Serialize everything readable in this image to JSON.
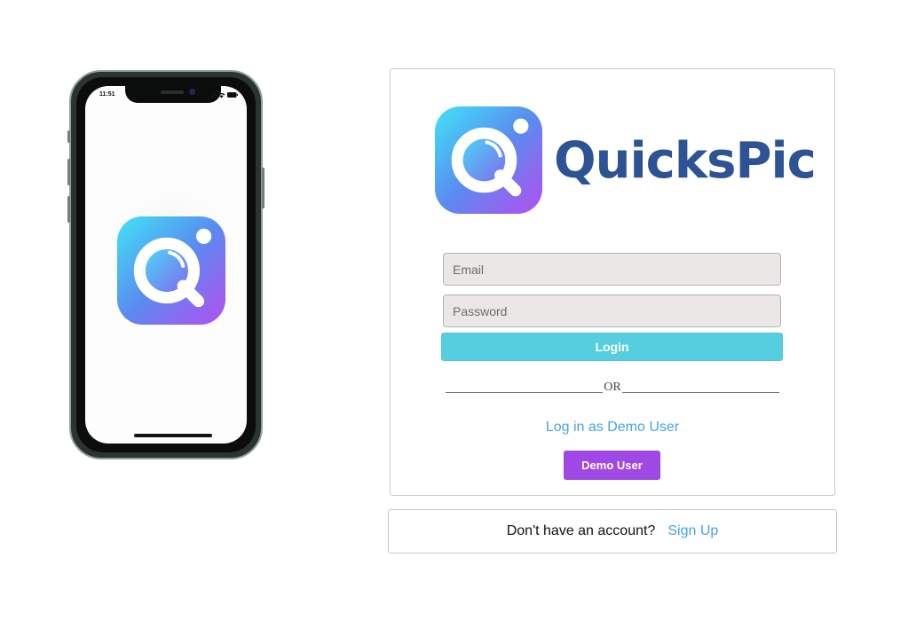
{
  "phone": {
    "status_time": "11:51",
    "icons": [
      "signal-icon",
      "wifi-icon",
      "battery-icon",
      "app-logo-icon"
    ]
  },
  "brand": {
    "name": "QuicksPic",
    "logo_icon": "quickspic-logo-icon",
    "colors": {
      "gradient_start": "#41e3f7",
      "gradient_mid": "#5a8bf0",
      "gradient_end": "#b54ef0",
      "wordmark": "#2e5394"
    }
  },
  "login_form": {
    "email": {
      "placeholder": "Email",
      "value": ""
    },
    "password": {
      "placeholder": "Password",
      "value": ""
    },
    "login_label": "Login",
    "divider_text": "OR",
    "demo_prompt": "Log in as Demo User",
    "demo_button_label": "Demo User",
    "colors": {
      "login_button": "#55cfdf",
      "demo_button": "#a048e3",
      "link": "#47a3e0"
    }
  },
  "signup": {
    "question": "Don't have an account?",
    "link_label": "Sign Up"
  }
}
